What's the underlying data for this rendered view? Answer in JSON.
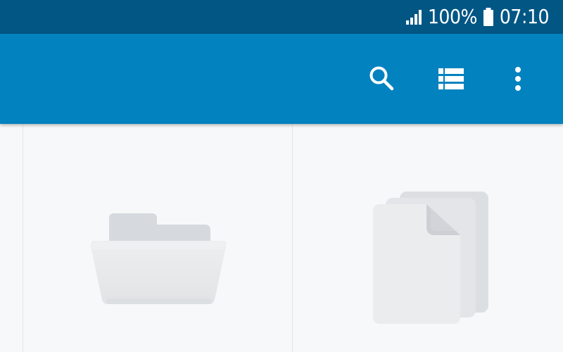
{
  "status_bar": {
    "signal_icon": "signal-icon",
    "battery_percent": "100%",
    "battery_icon": "battery-icon",
    "time": "07:10"
  },
  "toolbar": {
    "actions": [
      {
        "name": "search",
        "icon": "search-icon"
      },
      {
        "name": "list-view",
        "icon": "list-view-icon"
      },
      {
        "name": "more-options",
        "icon": "more-vert-icon"
      }
    ]
  },
  "grid": {
    "items": [
      {
        "type": "folder",
        "icon": "folder-icon"
      },
      {
        "type": "documents",
        "icon": "documents-icon"
      }
    ]
  },
  "colors": {
    "status_bar": "#015684",
    "app_bar": "#0282bf",
    "content_background": "#f7f8f9"
  }
}
